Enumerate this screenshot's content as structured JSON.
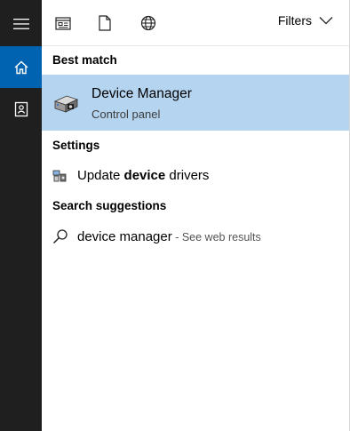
{
  "rail": {
    "items": [
      {
        "name": "hamburger-menu-icon"
      },
      {
        "name": "home-icon",
        "active": true
      },
      {
        "name": "notebook-icon"
      }
    ],
    "colors": {
      "background": "#1f1f1f",
      "active": "#0063b1"
    }
  },
  "topbar": {
    "icons": [
      "apps-icon",
      "documents-icon",
      "web-icon"
    ],
    "filters_label": "Filters"
  },
  "best_match": {
    "title": "Best match",
    "item": {
      "name": "Device Manager",
      "subtitle": "Control panel",
      "icon": "device-manager-icon",
      "highlight_color": "#b4d4f0"
    }
  },
  "settings": {
    "title": "Settings",
    "items": [
      {
        "prefix": "Update ",
        "bold": "device",
        "suffix": " drivers",
        "icon": "device-settings-icon"
      }
    ]
  },
  "suggestions": {
    "title": "Search suggestions",
    "items": [
      {
        "query": "device manager",
        "hint": " - See web results",
        "icon": "search-icon"
      }
    ]
  }
}
